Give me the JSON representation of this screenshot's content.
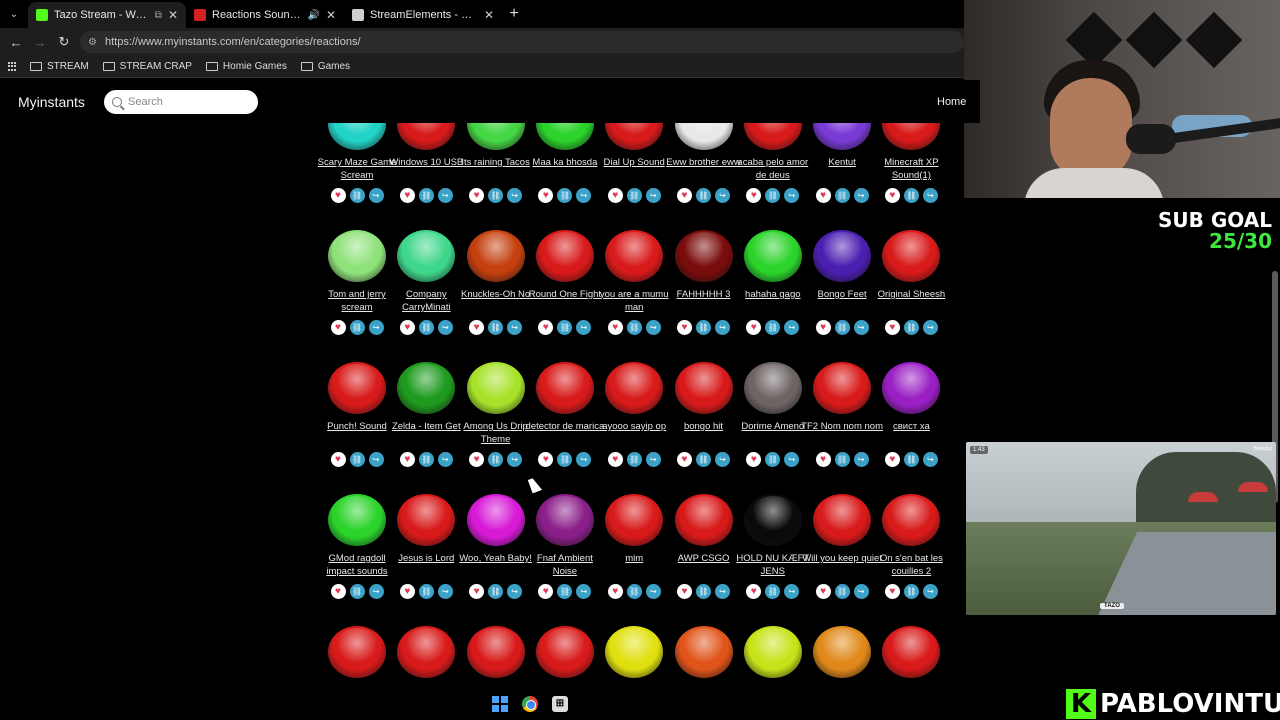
{
  "browser": {
    "tabs": [
      {
        "title": "Tazo Stream - Watch Live o",
        "favicon_color": "#53fc18",
        "active": true,
        "extra": "⧉"
      },
      {
        "title": "Reactions Soundboard - In",
        "favicon_color": "#d32020",
        "active": false,
        "extra": "🔊"
      },
      {
        "title": "StreamElements - pablovintura",
        "favicon_color": "#cfcfcf",
        "active": false,
        "extra": ""
      }
    ],
    "new_tab": "+",
    "url": "https://www.myinstants.com/en/categories/reactions/",
    "bookmarks": [
      "STREAM",
      "STREAM CRAP",
      "Homie Games",
      "Games"
    ]
  },
  "site": {
    "brand": "Myinstants",
    "search_placeholder": "Search",
    "nav_home": "Home"
  },
  "rows": [
    [
      {
        "label": "Scary Maze Game Scream",
        "color": "#22d3c8"
      },
      {
        "label": "Windows 10 USB",
        "color": "#d81a1a"
      },
      {
        "label": "Its raining Tacos",
        "color": "#45d645"
      },
      {
        "label": "Maa ka bhosda",
        "color": "#2bd32b"
      },
      {
        "label": "Dial Up Sound",
        "color": "#d81a1a"
      },
      {
        "label": "Eww brother eww",
        "color": "#e8e8e8"
      },
      {
        "label": "acaba pelo amor de deus",
        "color": "#d81a1a"
      },
      {
        "label": "Kentut",
        "color": "#7a3ad6"
      },
      {
        "label": "Minecraft XP Sound(1)",
        "color": "#d81a1a"
      }
    ],
    [
      {
        "label": "Tom and jerry scream",
        "color": "#8fe27a"
      },
      {
        "label": "Company CarryMinati",
        "color": "#3ed68a"
      },
      {
        "label": "Knuckles-Oh No",
        "color": "#c4400f"
      },
      {
        "label": "Round One Fight",
        "color": "#d81a1a"
      },
      {
        "label": "you are a mumu man",
        "color": "#d81a1a"
      },
      {
        "label": "FAHHHHH 3",
        "color": "#7a0c0c"
      },
      {
        "label": "hahaha gago",
        "color": "#2bd32b"
      },
      {
        "label": "Bongo Feet",
        "color": "#4a1fb0"
      },
      {
        "label": "Original Sheesh",
        "color": "#d81a1a"
      }
    ],
    [
      {
        "label": "Punch! Sound",
        "color": "#d81a1a"
      },
      {
        "label": "Zelda - Item Get",
        "color": "#1e9a1e"
      },
      {
        "label": "Among Us Drip Theme",
        "color": "#a6e22a"
      },
      {
        "label": "detector de marica",
        "color": "#d81a1a"
      },
      {
        "label": "ayooo sayip op",
        "color": "#d81a1a"
      },
      {
        "label": "bongo hit",
        "color": "#d81a1a"
      },
      {
        "label": "Dorime Ameno",
        "color": "#6e6464"
      },
      {
        "label": "TF2 Nom nom nom",
        "color": "#d81a1a"
      },
      {
        "label": "свист ха",
        "color": "#9a1fc4"
      }
    ],
    [
      {
        "label": "GMod ragdoll impact sounds",
        "color": "#2bd32b"
      },
      {
        "label": "Jesus is Lord",
        "color": "#d81a1a"
      },
      {
        "label": "Woo, Yeah Baby!",
        "color": "#d61ad6"
      },
      {
        "label": "Fnaf Ambient Noise",
        "color": "#8a1f8a"
      },
      {
        "label": "mim",
        "color": "#d81a1a"
      },
      {
        "label": "AWP CSGO",
        "color": "#d81a1a"
      },
      {
        "label": "HOLD NU KÆFT JENS",
        "color": "#0a0a0a"
      },
      {
        "label": "Will you keep quiet",
        "color": "#d81a1a"
      },
      {
        "label": "On s'en bat les couilles 2",
        "color": "#d81a1a"
      }
    ],
    [
      {
        "label": "",
        "color": "#d81a1a"
      },
      {
        "label": "",
        "color": "#d81a1a"
      },
      {
        "label": "",
        "color": "#d81a1a"
      },
      {
        "label": "",
        "color": "#d81a1a"
      },
      {
        "label": "",
        "color": "#e0e010"
      },
      {
        "label": "",
        "color": "#e0541a"
      },
      {
        "label": "",
        "color": "#c8e21a"
      },
      {
        "label": "",
        "color": "#e0891a"
      },
      {
        "label": "",
        "color": "#d81a1a"
      }
    ]
  ],
  "action_icons": {
    "favorite": "♥",
    "copy_link": "🔗",
    "share": "↪"
  },
  "overlay": {
    "sub_goal_title": "SUB GOAL",
    "sub_goal_value": "25/30",
    "channel_name": "PABLOVINTURA",
    "kick_letter": "K",
    "video_time": "1:43",
    "video_location": "Bedugul",
    "video_logo": "TAZO"
  },
  "taskbar": {
    "app_label": "⊞"
  }
}
